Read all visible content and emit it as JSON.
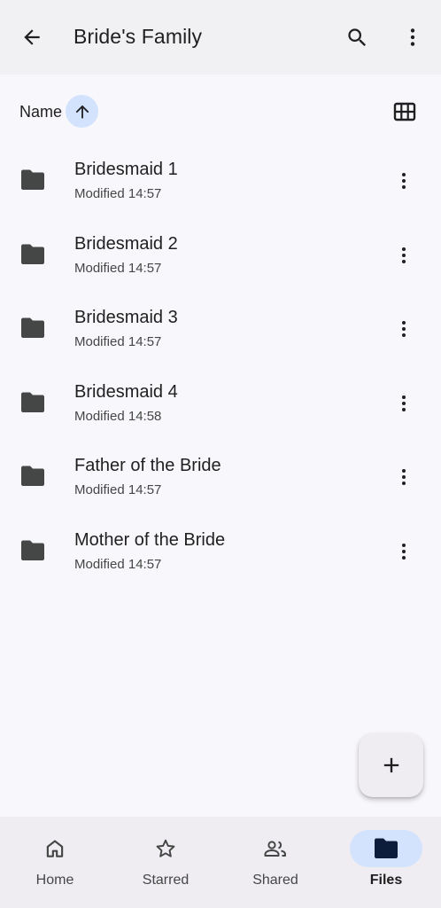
{
  "header": {
    "title": "Bride's Family",
    "back_icon": "arrow-back-icon",
    "search_icon": "search-icon",
    "more_icon": "more-vert-icon"
  },
  "sort": {
    "label": "Name",
    "direction_icon": "arrow-upward-icon",
    "view_icon": "grid-view-icon"
  },
  "files": [
    {
      "name": "Bridesmaid 1",
      "modified": "Modified 14:57"
    },
    {
      "name": "Bridesmaid 2",
      "modified": "Modified 14:57"
    },
    {
      "name": "Bridesmaid 3",
      "modified": "Modified 14:57"
    },
    {
      "name": "Bridesmaid 4",
      "modified": "Modified 14:58"
    },
    {
      "name": "Father of the Bride",
      "modified": "Modified 14:57"
    },
    {
      "name": "Mother of the Bride",
      "modified": "Modified 14:57"
    }
  ],
  "fab": {
    "icon": "add-icon"
  },
  "bottom_nav": [
    {
      "label": "Home",
      "icon": "home-icon",
      "active": false
    },
    {
      "label": "Starred",
      "icon": "star-icon",
      "active": false
    },
    {
      "label": "Shared",
      "icon": "people-icon",
      "active": false
    },
    {
      "label": "Files",
      "icon": "folder-icon",
      "active": true
    }
  ],
  "colors": {
    "accent": "#d3e3fd",
    "icon_dark": "#444746",
    "background": "#f8f7fb",
    "bar_background": "#efedf1"
  }
}
